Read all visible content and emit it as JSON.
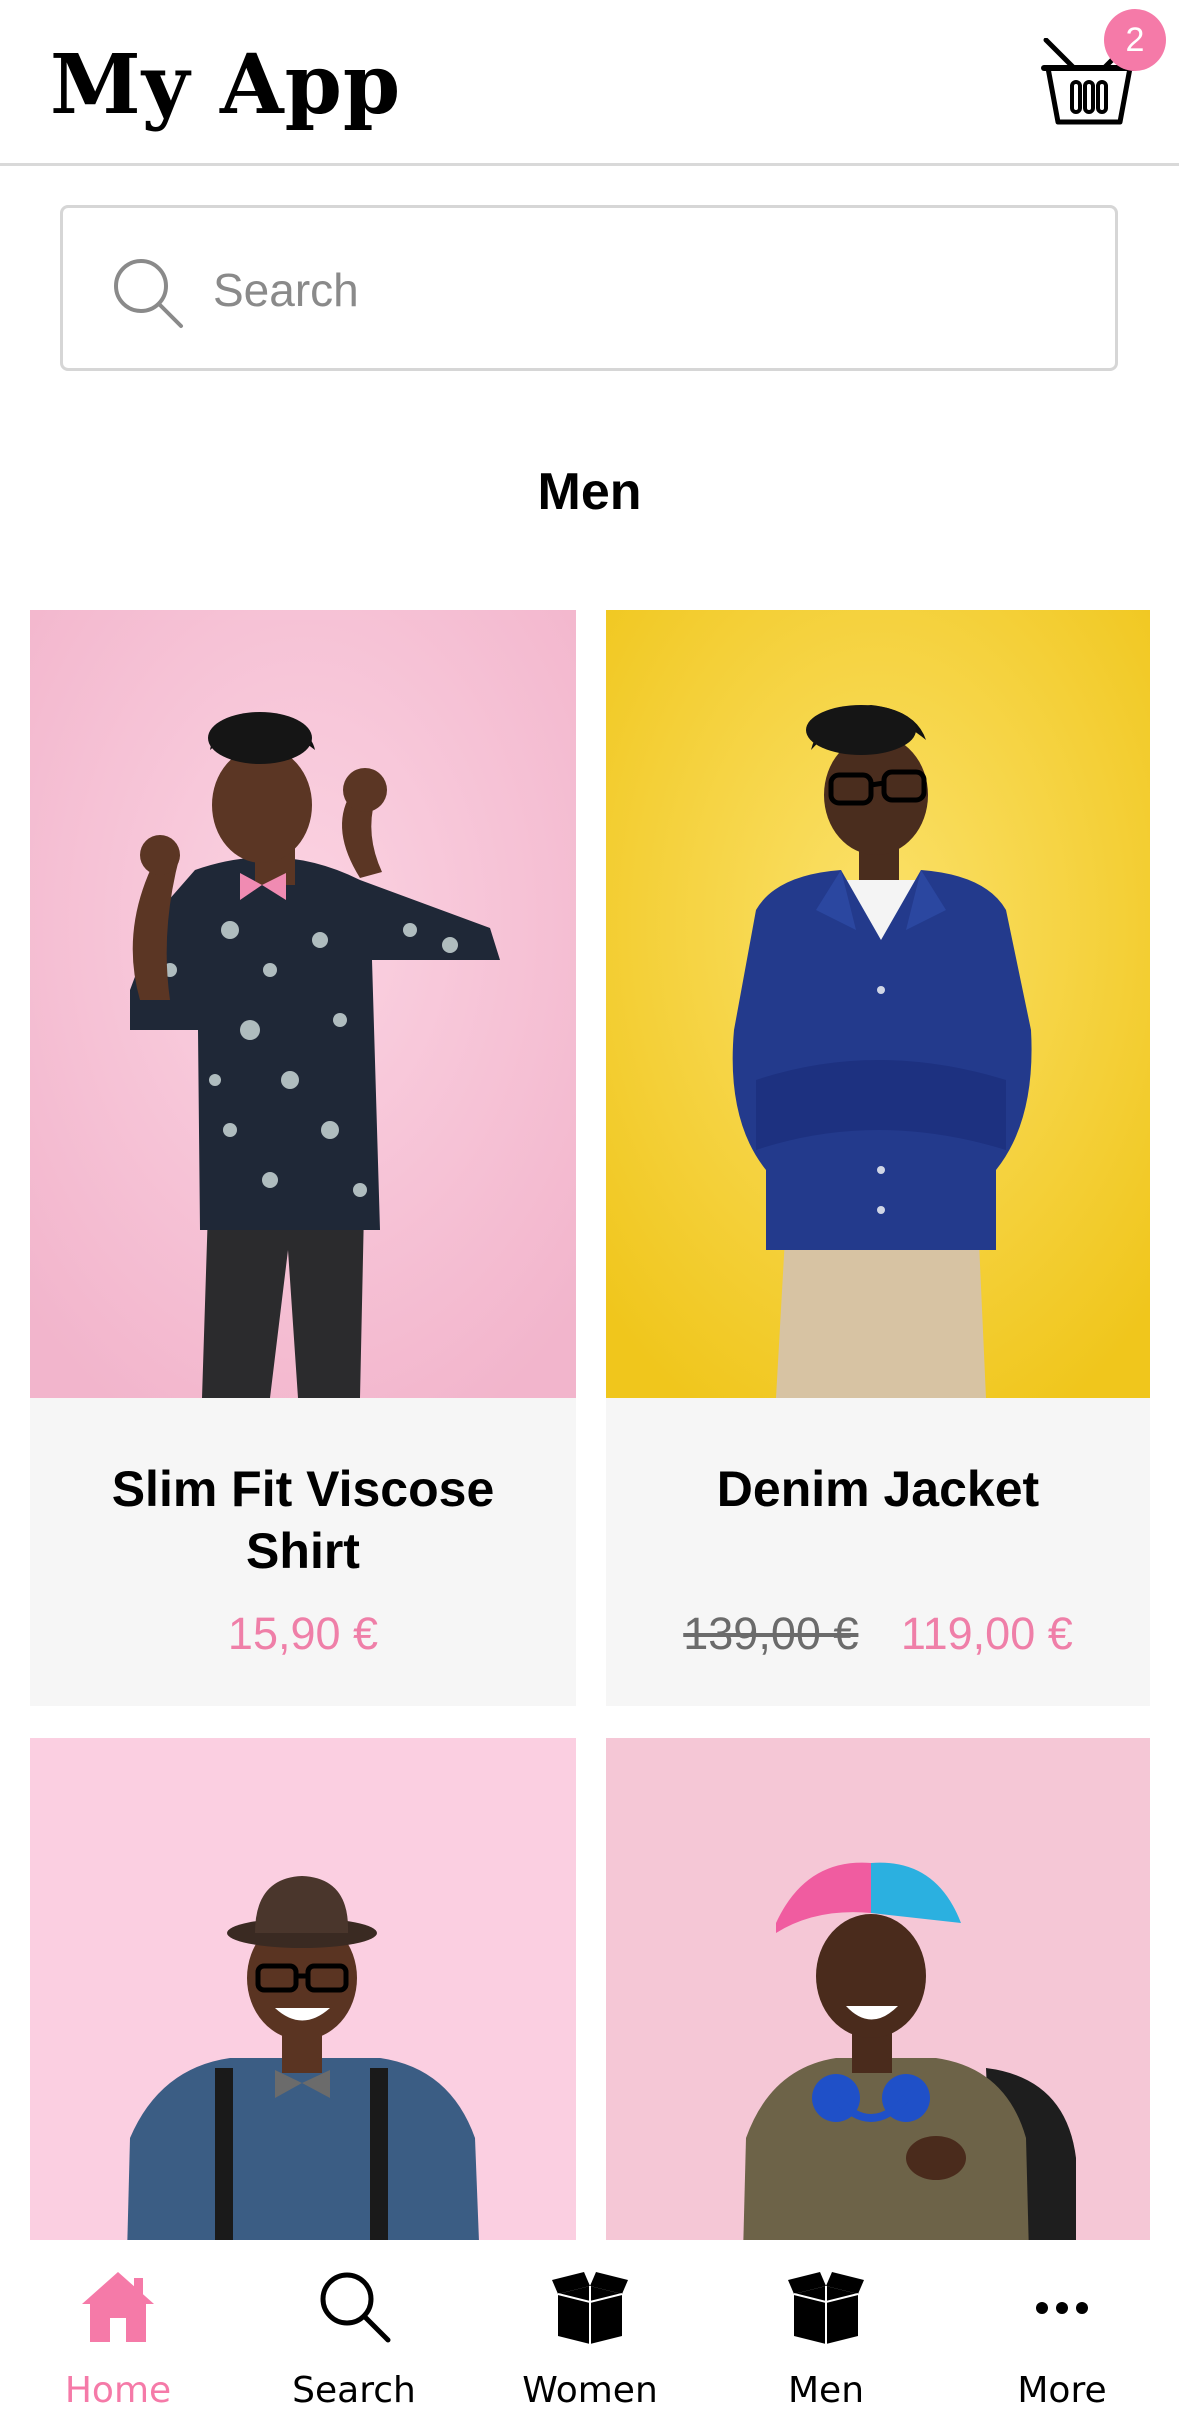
{
  "header": {
    "title": "My App",
    "cart_count": "2"
  },
  "search": {
    "placeholder": "Search"
  },
  "section": {
    "title": "Men"
  },
  "products": [
    {
      "name": "Slim Fit Viscose Shirt",
      "price": "15,90 €",
      "old_price": "",
      "image": "man-floral-shirt-pink-background"
    },
    {
      "name": "Denim Jacket",
      "price": "119,00 €",
      "old_price": "139,00 €",
      "image": "man-denim-jacket-yellow-background"
    },
    {
      "name": "",
      "price": "",
      "old_price": "",
      "image": "man-hat-glasses-denim-shirt-pink-background"
    },
    {
      "name": "",
      "price": "",
      "old_price": "",
      "image": "man-cap-headphones-backpack-pink-background"
    }
  ],
  "tabbar": {
    "tabs": [
      {
        "label": "Home",
        "icon": "home-icon",
        "active": true
      },
      {
        "label": "Search",
        "icon": "search-icon",
        "active": false
      },
      {
        "label": "Women",
        "icon": "box-icon",
        "active": false
      },
      {
        "label": "Men",
        "icon": "box-icon",
        "active": false
      },
      {
        "label": "More",
        "icon": "more-icon",
        "active": false
      }
    ]
  },
  "colors": {
    "accent": "#f57aa8",
    "price": "#ef7fa8",
    "card_bg": "#f6f6f6",
    "pink_bg": "#f7c6d8",
    "yellow_bg": "#f5cf2e"
  }
}
